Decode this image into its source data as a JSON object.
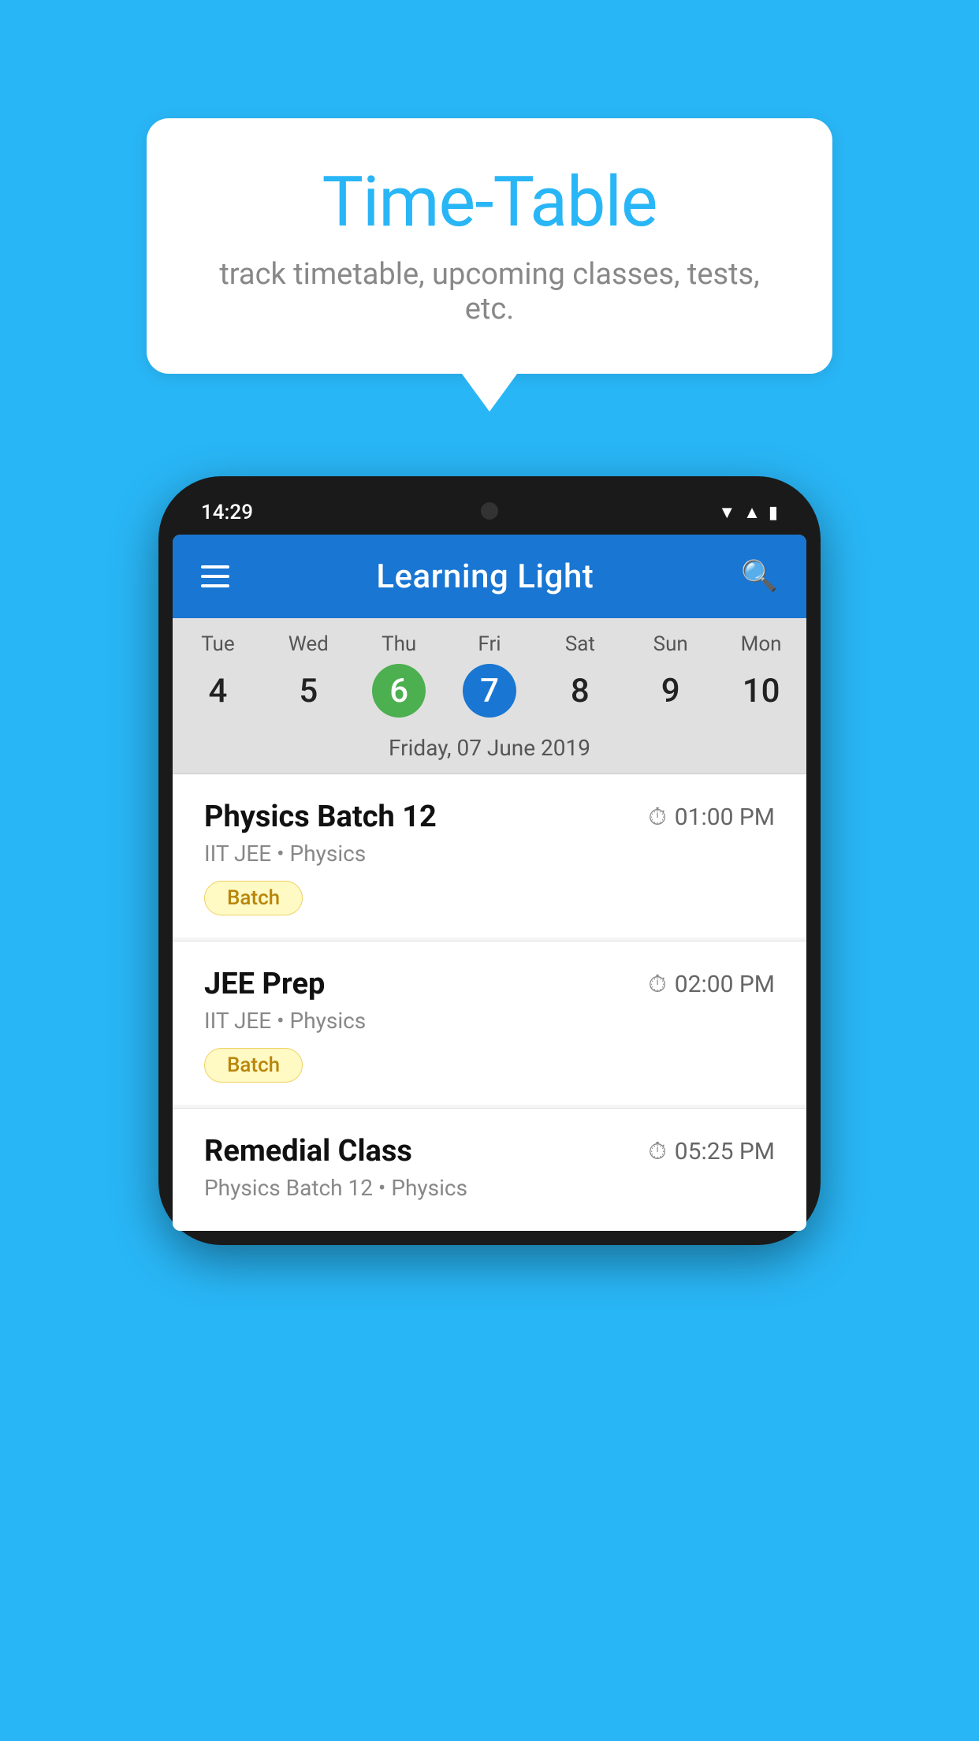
{
  "background_color": "#29B6F6",
  "bubble": {
    "title": "Time-Table",
    "subtitle": "track timetable, upcoming classes, tests, etc."
  },
  "phone": {
    "status_bar": {
      "time": "14:29"
    },
    "toolbar": {
      "title": "Learning Light",
      "menu_label": "menu",
      "search_label": "search"
    },
    "calendar": {
      "days": [
        {
          "name": "Tue",
          "num": "4",
          "state": "normal"
        },
        {
          "name": "Wed",
          "num": "5",
          "state": "normal"
        },
        {
          "name": "Thu",
          "num": "6",
          "state": "today"
        },
        {
          "name": "Fri",
          "num": "7",
          "state": "selected"
        },
        {
          "name": "Sat",
          "num": "8",
          "state": "normal"
        },
        {
          "name": "Sun",
          "num": "9",
          "state": "normal"
        },
        {
          "name": "Mon",
          "num": "10",
          "state": "normal"
        }
      ],
      "selected_date_label": "Friday, 07 June 2019"
    },
    "events": [
      {
        "title": "Physics Batch 12",
        "time": "01:00 PM",
        "meta": "IIT JEE • Physics",
        "badge": "Batch"
      },
      {
        "title": "JEE Prep",
        "time": "02:00 PM",
        "meta": "IIT JEE • Physics",
        "badge": "Batch"
      },
      {
        "title": "Remedial Class",
        "time": "05:25 PM",
        "meta": "Physics Batch 12 • Physics",
        "badge": null
      }
    ]
  }
}
